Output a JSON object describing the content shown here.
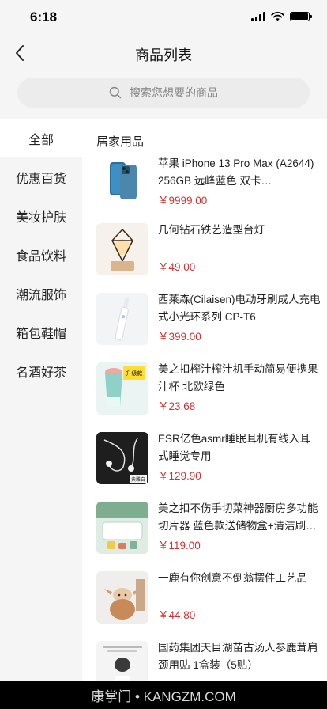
{
  "status": {
    "time": "6:18"
  },
  "nav": {
    "title": "商品列表"
  },
  "search": {
    "placeholder": "搜索您想要的商品"
  },
  "sidebar": {
    "items": [
      {
        "label": "全部",
        "active": true
      },
      {
        "label": "优惠百货"
      },
      {
        "label": "美妆护肤"
      },
      {
        "label": "食品饮料"
      },
      {
        "label": "潮流服饰"
      },
      {
        "label": "箱包鞋帽"
      },
      {
        "label": "名酒好茶"
      }
    ]
  },
  "content": {
    "section_title": "居家用品",
    "products": [
      {
        "name": "苹果 iPhone 13 Pro Max (A2644) 256GB 远峰蓝色 双卡…",
        "price": "￥9999.00",
        "icon": "iphone-image"
      },
      {
        "name": "几何钻石铁艺造型台灯",
        "price": "￥49.00",
        "icon": "lamp-image"
      },
      {
        "name": "西莱森(Cilaisen)电动牙刷成人充电式小光环系列 CP-T6",
        "price": "￥399.00",
        "icon": "toothbrush-image"
      },
      {
        "name": "美之扣榨汁榨汁机手动简易便携果汁杯 北欧绿色",
        "price": "￥23.68",
        "icon": "juicer-image",
        "thumb_badge": "升级款"
      },
      {
        "name": "ESR亿色asmr睡眠耳机有线入耳式睡觉专用",
        "price": "￥129.90",
        "icon": "earphones-image",
        "thumb_badge": "典雅白"
      },
      {
        "name": "美之扣不伤手切菜神器厨房多功能切片器 蓝色款送储物盒+清洁刷…",
        "price": "￥119.00",
        "icon": "slicer-image"
      },
      {
        "name": "一鹿有你创意不倒翁摆件工艺品",
        "price": "￥44.80",
        "icon": "deer-tumbler-image"
      },
      {
        "name": "国药集团天目湖苗古汤人参鹿茸肩颈用贴 1盒装（5贴）",
        "price": "",
        "icon": "patch-image"
      }
    ]
  },
  "watermark": {
    "text": "康掌门 • KANGZM.COM"
  },
  "colors": {
    "price": "#d43030",
    "background": "#f5f5f5"
  }
}
